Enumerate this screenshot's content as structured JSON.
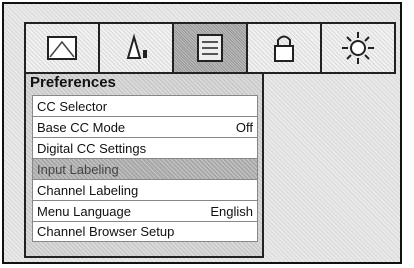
{
  "top_tabs": [
    {
      "icon": "picture-icon",
      "active": false
    },
    {
      "icon": "audio-icon",
      "active": false
    },
    {
      "icon": "preferences-icon",
      "active": true
    },
    {
      "icon": "lock-icon",
      "active": false
    },
    {
      "icon": "setup-sun-icon",
      "active": false
    }
  ],
  "menu": {
    "title": "Preferences",
    "items": [
      {
        "label": "CC Selector",
        "value": ""
      },
      {
        "label": "Base CC Mode",
        "value": "Off"
      },
      {
        "label": "Digital CC Settings",
        "value": ""
      },
      {
        "label": "Input Labeling",
        "value": "",
        "highlighted": true
      },
      {
        "label": "Channel Labeling",
        "value": ""
      },
      {
        "label": "Menu Language",
        "value": "English"
      },
      {
        "label": "Channel Browser Setup",
        "value": ""
      }
    ]
  }
}
